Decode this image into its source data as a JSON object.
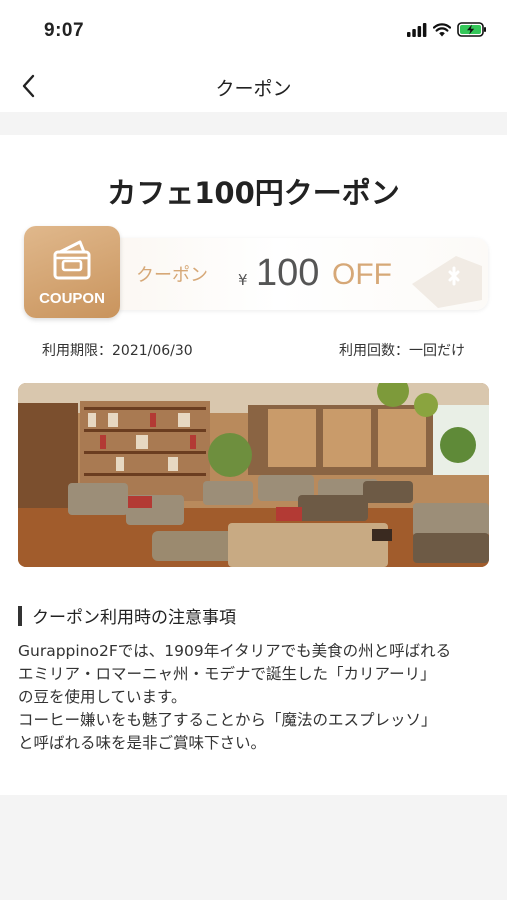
{
  "status_bar": {
    "time": "9:07"
  },
  "nav": {
    "title": "クーポン",
    "back_icon": "chevron-left-icon"
  },
  "coupon": {
    "title": "カフェ100円クーポン",
    "badge_label": "COUPON",
    "label": "クーポン",
    "currency": "¥",
    "amount": "100",
    "off_label": "OFF",
    "accent_color": "#d6a877",
    "expiry": "利用期限：2021/06/30",
    "usage": "利用回数：一回だけ"
  },
  "photo": {
    "description_icon": "cafe-interior-photo"
  },
  "notes": {
    "heading": "クーポン利用時の注意事項",
    "lines": [
      "Gurappino2Fでは、1909年イタリアでも美食の州と呼ばれる",
      "エミリア・ロマーニャ州・モデナで誕生した「カリアーリ」",
      "の豆を使用しています。",
      "コーヒー嫌いをも魅了することから「魔法のエスプレッソ」",
      "と呼ばれる味を是非ご賞味下さい。"
    ]
  }
}
